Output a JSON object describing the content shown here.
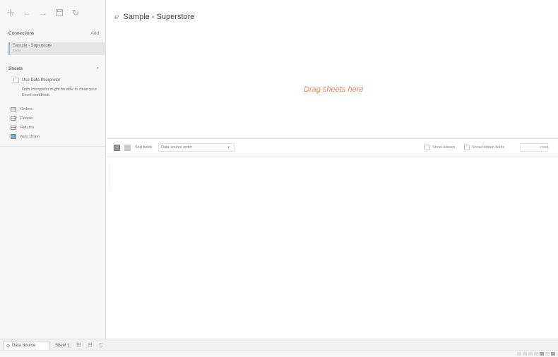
{
  "toolbar": {
    "icons": [
      "tableau-logo-icon",
      "back-icon",
      "forward-icon",
      "save-icon",
      "refresh-icon"
    ]
  },
  "connections": {
    "heading": "Connections",
    "add_label": "Add",
    "items": [
      {
        "name": "Sample - Superstore",
        "type": "Excel"
      }
    ]
  },
  "sheets": {
    "heading": "Sheets",
    "use_interpreter_label": "Use Data Interpreter",
    "interpreter_description": "Data Interpreter might be able to clean your Excel workbook.",
    "items": [
      {
        "label": "Orders",
        "icon": "table-icon"
      },
      {
        "label": "People",
        "icon": "table-icon"
      },
      {
        "label": "Returns",
        "icon": "table-icon"
      },
      {
        "label": "New Union",
        "icon": "union-icon"
      }
    ]
  },
  "main": {
    "datasource_title": "Sample - Superstore",
    "drag_hint": "Drag sheets here",
    "accent_color": "#e9875a"
  },
  "grid_toolbar": {
    "sort_label": "Sort fields",
    "sort_value": "Data source order",
    "show_aliases_label": "Show aliases",
    "show_hidden_label": "Show hidden fields",
    "rows_label": "rows"
  },
  "tabs": {
    "data_source_label": "Data Source",
    "sheet_label": "Sheet 1"
  }
}
